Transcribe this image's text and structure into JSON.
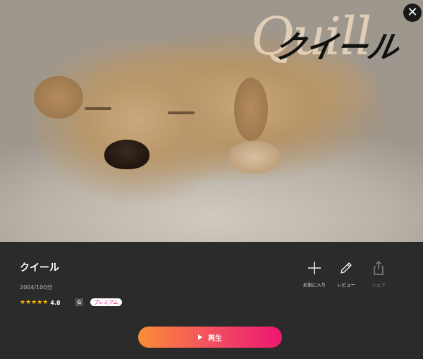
{
  "hero": {
    "logo_script": "Quill",
    "logo_kana": "クイール",
    "close_icon": "close-icon"
  },
  "details": {
    "title": "クイール",
    "meta": "2004/100分",
    "rating_stars": "★★★★★",
    "rating_score": "4.8",
    "age_rating": "G",
    "premium_badge": "プレミアム"
  },
  "actions": [
    {
      "label": "お気に入り",
      "icon": "plus-icon"
    },
    {
      "label": "レビュー",
      "icon": "pencil-icon"
    },
    {
      "label": "シェア",
      "icon": "share-icon"
    }
  ],
  "play_button": {
    "label": "再生",
    "icon": "play-icon"
  },
  "colors": {
    "background": "#2b2b2b",
    "star": "#f6b400",
    "play_gradient_start": "#fb8c37",
    "play_gradient_end": "#ee1670",
    "premium_text": "#e0117b"
  }
}
